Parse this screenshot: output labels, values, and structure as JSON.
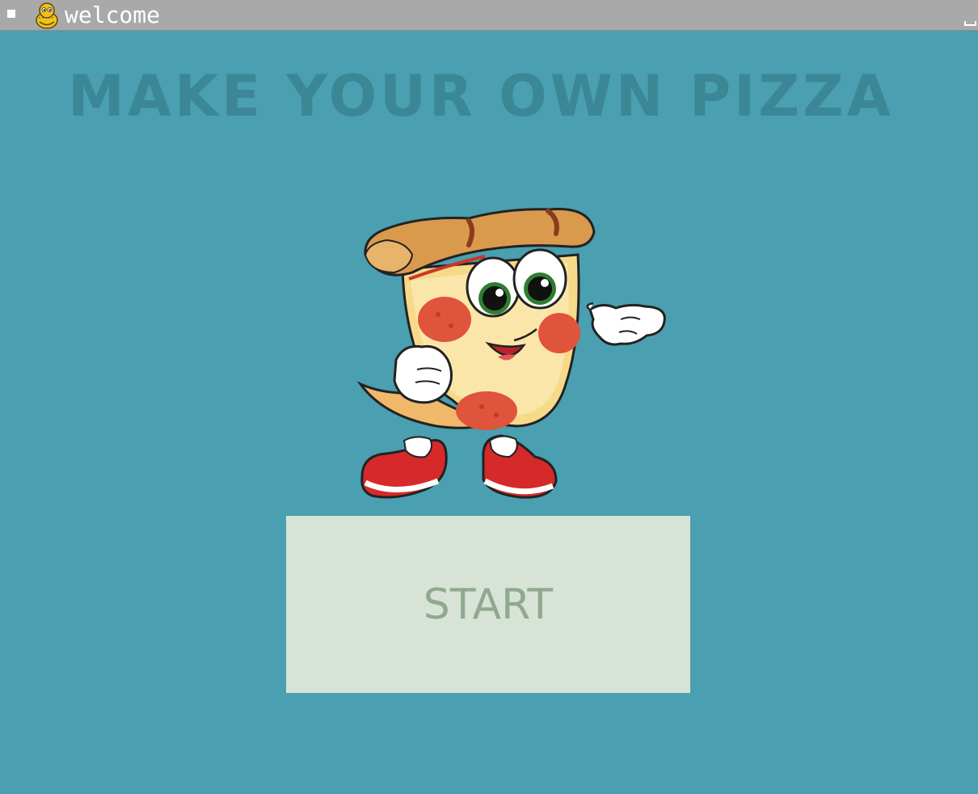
{
  "window": {
    "title": "welcome",
    "app_icon": "pygame-snake-icon",
    "system_menu_icon": "system-menu-icon",
    "minimize_icon": "minimize-icon"
  },
  "screen": {
    "heading": "MAKE YOUR OWN PIZZA",
    "mascot": "pizza-slice-mascot-illustration",
    "start_button_label": "START"
  },
  "colors": {
    "background": "#4a9fb0",
    "heading": "#3b8796",
    "titlebar": "#a9a9a9",
    "button_bg": "#d8e3d8",
    "button_text": "#8fa98f"
  }
}
